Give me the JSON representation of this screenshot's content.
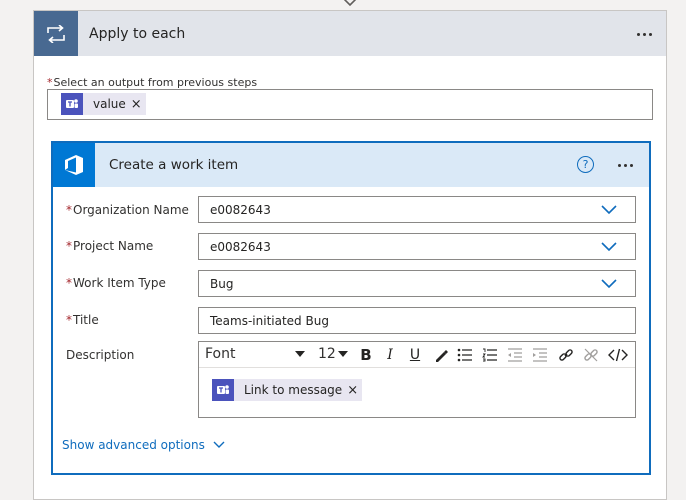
{
  "apply_each": {
    "title": "Apply to each",
    "select_label": "Select an output from previous steps",
    "required_mark": "*",
    "token_value": "value",
    "token_remove": "×"
  },
  "action": {
    "title": "Create a work item",
    "help": "?",
    "fields": [
      {
        "label": "Organization Name",
        "value": "e0082643",
        "required": "*"
      },
      {
        "label": "Project Name",
        "value": "e0082643",
        "required": "*"
      },
      {
        "label": "Work Item Type",
        "value": "Bug",
        "required": "*"
      },
      {
        "label": "Title",
        "value": "Teams-initiated Bug",
        "required": "*"
      }
    ],
    "description": {
      "label": "Description",
      "font": "Font",
      "size": "12",
      "token": "Link to message",
      "token_remove": "×"
    },
    "advanced_link": "Show advanced options"
  },
  "colors": {
    "loop_header": "#486991",
    "ado_blue": "#0078d4",
    "teams_purple": "#4b53bc",
    "focus_border": "#0f6cbd"
  }
}
